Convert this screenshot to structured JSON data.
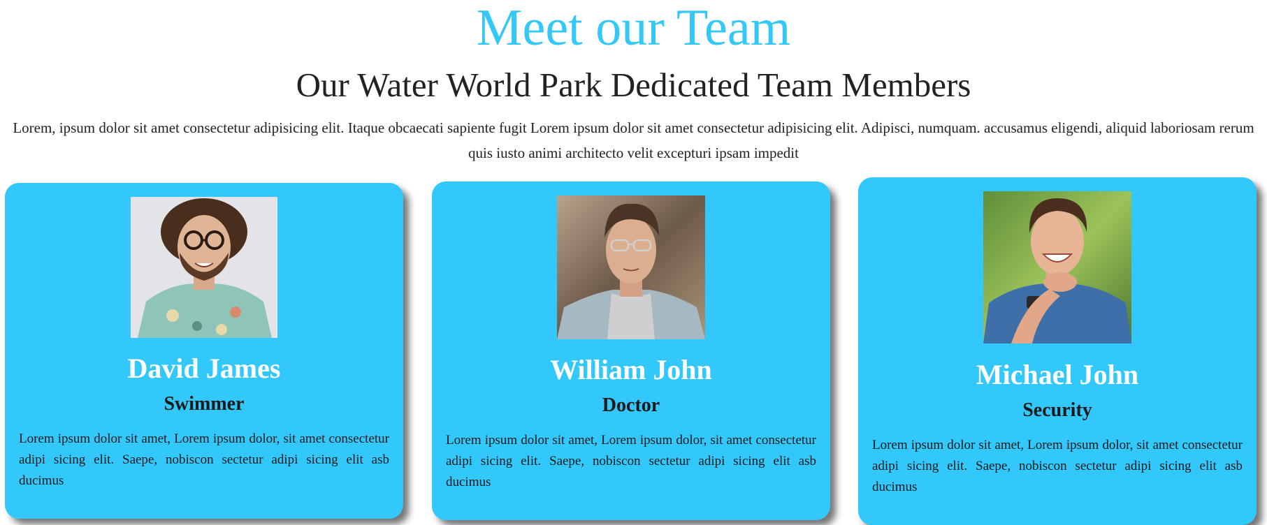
{
  "header": {
    "title": "Meet our Team",
    "subtitle": "Our Water World Park Dedicated Team Members",
    "intro": "Lorem, ipsum dolor sit amet consectetur adipisicing elit. Itaque obcaecati sapiente fugit Lorem ipsum dolor sit amet consectetur adipisicing elit. Adipisci, numquam. accusamus eligendi, aliquid laboriosam rerum quis iusto animi architecto velit excepturi ipsam impedit"
  },
  "team": [
    {
      "name": "David James",
      "role": "Swimmer",
      "description": "Lorem ipsum dolor sit amet, Lorem ipsum dolor, sit amet consectetur adipi sicing elit. Saepe, nobiscon sectetur adipi sicing elit asb ducimus"
    },
    {
      "name": "William John",
      "role": "Doctor",
      "description": "Lorem ipsum dolor sit amet, Lorem ipsum dolor, sit amet consectetur adipi sicing elit. Saepe, nobiscon sectetur adipi sicing elit asb ducimus"
    },
    {
      "name": "Michael John",
      "role": "Security",
      "description": "Lorem ipsum dolor sit amet, Lorem ipsum dolor, sit amet consectetur adipi sicing elit. Saepe, nobiscon sectetur adipi sicing elit asb ducimus"
    }
  ],
  "colors": {
    "accent": "#33c8f5",
    "card_background": "#33c8fc",
    "name_text": "#ffffff",
    "body_text": "#222222"
  }
}
